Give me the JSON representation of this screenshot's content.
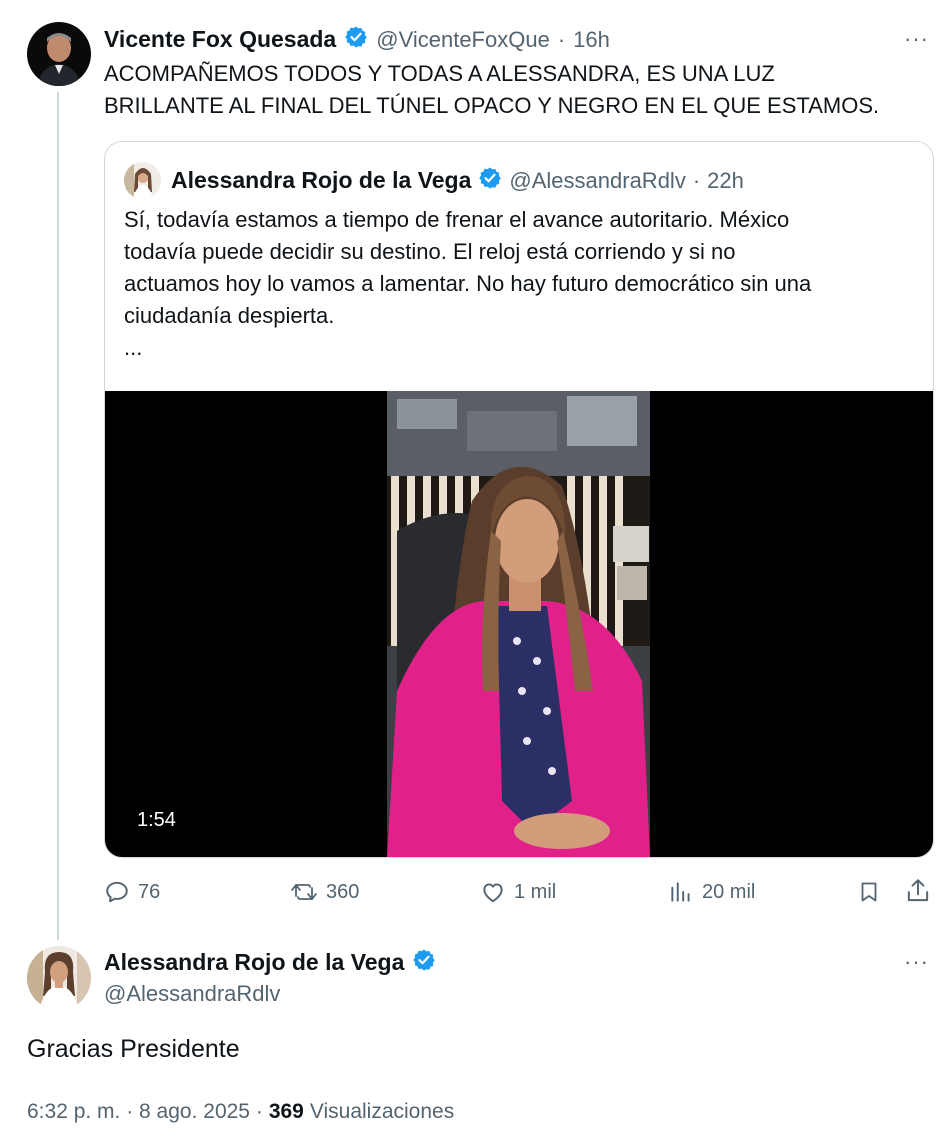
{
  "main_tweet": {
    "author_name": "Vicente Fox Quesada",
    "handle": "@VicenteFoxQue",
    "separator": "·",
    "time": "16h",
    "text_line1": "ACOMPAÑEMOS TODOS Y TODAS A ALESSANDRA, ES UNA LUZ",
    "text_line2": "BRILLANTE AL FINAL DEL TÚNEL OPACO Y NEGRO EN EL QUE ESTAMOS.",
    "more": "···"
  },
  "quoted_tweet": {
    "author_name": "Alessandra Rojo de la Vega",
    "handle": "@AlessandraRdlv",
    "separator": "·",
    "time": "22h",
    "text_lines": [
      "Sí, todavía estamos a tiempo de frenar el avance autoritario. México",
      "todavía puede decidir su destino. El reloj está corriendo y si no",
      "actuamos hoy lo vamos a lamentar. No hay futuro democrático sin una",
      "ciudadanía despierta.",
      "..."
    ],
    "video_duration": "1:54"
  },
  "actions": {
    "replies": "76",
    "reposts": "360",
    "likes": "1 mil",
    "views": "20 mil"
  },
  "reply_tweet": {
    "author_name": "Alessandra Rojo de la Vega",
    "handle": "@AlessandraRdlv",
    "text": "Gracias Presidente",
    "more": "···",
    "timestamp": "6:32 p. m. · 8 ago. 2025 ·",
    "views_count": "369",
    "views_label": "Visualizaciones"
  },
  "colors": {
    "verified": "#1d9bf0",
    "muted": "#536471",
    "border": "#cfd9de",
    "blazer": "#e0218a"
  }
}
